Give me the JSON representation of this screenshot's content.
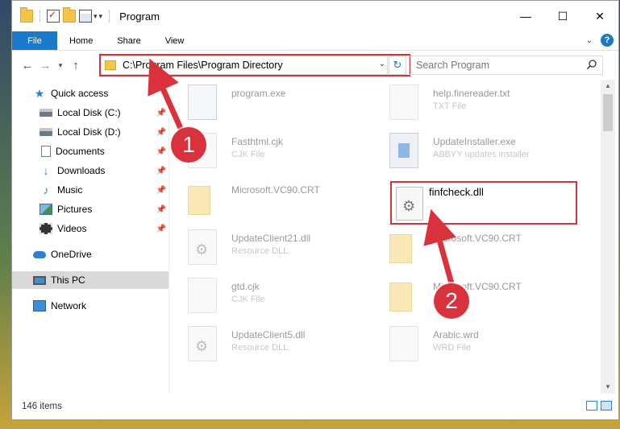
{
  "window": {
    "title": "Program",
    "controls": {
      "minimize": "—",
      "maximize": "☐",
      "close": "✕"
    }
  },
  "ribbon": {
    "tabs": [
      "File",
      "Home",
      "Share",
      "View"
    ]
  },
  "address": {
    "path": "C:\\Program Files\\Program Directory"
  },
  "search": {
    "placeholder": "Search Program"
  },
  "sidebar": {
    "items": [
      {
        "label": "Quick access",
        "icon": "star-icon"
      },
      {
        "label": "Local Disk (C:)",
        "icon": "disk-icon"
      },
      {
        "label": "Local Disk (D:)",
        "icon": "disk-icon"
      },
      {
        "label": "Documents",
        "icon": "documents-icon"
      },
      {
        "label": "Downloads",
        "icon": "downloads-icon"
      },
      {
        "label": "Music",
        "icon": "music-icon"
      },
      {
        "label": "Pictures",
        "icon": "pictures-icon"
      },
      {
        "label": "Videos",
        "icon": "videos-icon"
      },
      {
        "label": "OneDrive",
        "icon": "cloud-icon"
      },
      {
        "label": "This PC",
        "icon": "pc-icon"
      },
      {
        "label": "Network",
        "icon": "network-icon"
      }
    ]
  },
  "files": [
    {
      "name": "program.exe",
      "type": ""
    },
    {
      "name": "help.finereader.txt",
      "type": "TXT File"
    },
    {
      "name": "Fasthtml.cjk",
      "type": "CJK File"
    },
    {
      "name": "UpdateInstaller.exe",
      "type": "ABBYY updates installer"
    },
    {
      "name": "Microsoft.VC90.CRT",
      "type": ""
    },
    {
      "name": "UpdateClient21.dll",
      "type": "Resource DLL"
    },
    {
      "name": "Microsoft.VC90.CRT",
      "type": ""
    },
    {
      "name": "gtd.cjk",
      "type": "CJK File"
    },
    {
      "name": "Microsoft.VC90.CRT",
      "type": ""
    },
    {
      "name": "UpdateClient5.dll",
      "type": "Resource DLL"
    },
    {
      "name": "Arabic.wrd",
      "type": "WRD File"
    }
  ],
  "highlighted_file": {
    "name": "finfcheck.dll"
  },
  "status": {
    "count": "146 items"
  },
  "annotations": {
    "step1": "1",
    "step2": "2"
  },
  "colors": {
    "accent": "#1979ca",
    "highlight": "#d6323a"
  }
}
